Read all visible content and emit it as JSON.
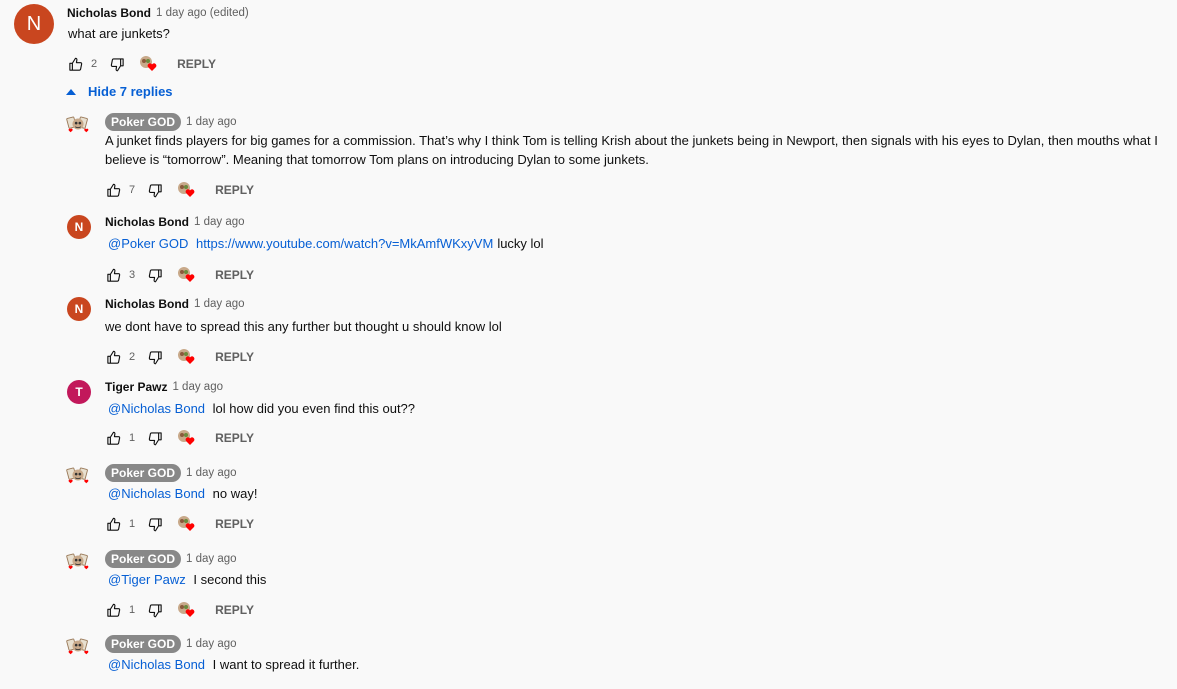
{
  "top_comment": {
    "avatar_letter": "N",
    "avatar_color": "#c9461f",
    "author": "Nicholas Bond",
    "time": "1 day ago (edited)",
    "text": "what are junkets?",
    "likes": "2",
    "reply_label": "REPLY"
  },
  "toggle": {
    "label": "Hide 7 replies",
    "icon": "caret-up-icon"
  },
  "replies": [
    {
      "author": "Poker GOD",
      "badge": true,
      "time": "1 day ago",
      "mention": "",
      "text": "A junket finds players for big games for a commission. That’s why I think Tom is telling Krish about the junkets being in Newport, then signals with his eyes to Dylan, then mouths what I believe is “tomorrow”. Meaning that tomorrow Tom plans on introducing Dylan to some junkets.",
      "likes": "7",
      "reply_label": "REPLY"
    },
    {
      "author": "Nicholas Bond",
      "avatar_letter": "N",
      "avatar_color": "#c9461f",
      "time": "1 day ago",
      "mention": "@Poker GOD",
      "link": "https://www.youtube.com/watch?v=MkAmfWKxyVM",
      "text": "lucky lol",
      "likes": "3",
      "reply_label": "REPLY"
    },
    {
      "author": "Nicholas Bond",
      "avatar_letter": "N",
      "avatar_color": "#c9461f",
      "time": "1 day ago",
      "mention": "",
      "text": "we dont have to spread this any further but thought u should know lol",
      "likes": "2",
      "reply_label": "REPLY"
    },
    {
      "author": "Tiger Pawz",
      "avatar_letter": "T",
      "avatar_color": "#c2185b",
      "time": "1 day ago",
      "mention": "@Nicholas Bond",
      "text": "lol how did you even find this out??",
      "likes": "1",
      "reply_label": "REPLY"
    },
    {
      "author": "Poker GOD",
      "badge": true,
      "time": "1 day ago",
      "mention": "@Nicholas Bond",
      "text": "no way!",
      "likes": "1",
      "reply_label": "REPLY"
    },
    {
      "author": "Poker GOD",
      "badge": true,
      "time": "1 day ago",
      "mention": "@Tiger Pawz",
      "text": "I second this",
      "likes": "1",
      "reply_label": "REPLY"
    },
    {
      "author": "Poker GOD",
      "badge": true,
      "time": "1 day ago",
      "mention": "@Nicholas Bond",
      "text": "I want to spread it further."
    }
  ],
  "colors": {
    "link": "#065fd4",
    "heart": "#ff0000",
    "badge_bg": "#888888"
  }
}
